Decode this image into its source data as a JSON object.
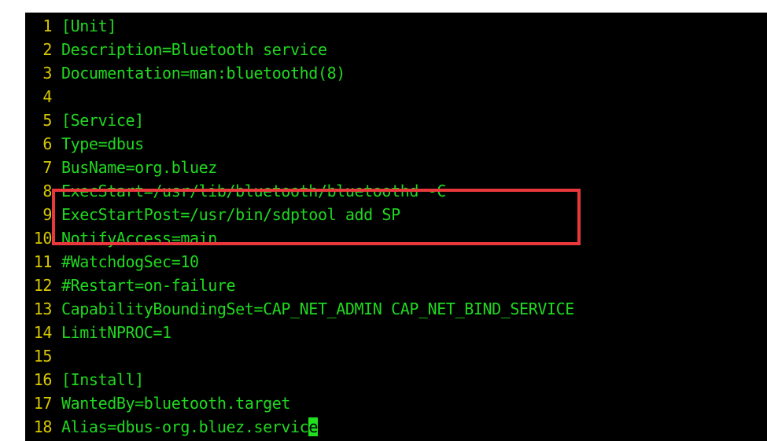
{
  "editor": {
    "lines": [
      {
        "num": "1",
        "text": "[Unit]"
      },
      {
        "num": "2",
        "text": "Description=Bluetooth service"
      },
      {
        "num": "3",
        "text": "Documentation=man:bluetoothd(8)"
      },
      {
        "num": "4",
        "text": ""
      },
      {
        "num": "5",
        "text": "[Service]"
      },
      {
        "num": "6",
        "text": "Type=dbus"
      },
      {
        "num": "7",
        "text": "BusName=org.bluez"
      },
      {
        "num": "8",
        "text": "ExecStart=/usr/lib/bluetooth/bluetoothd -C"
      },
      {
        "num": "9",
        "text": "ExecStartPost=/usr/bin/sdptool add SP"
      },
      {
        "num": "10",
        "text": "NotifyAccess=main"
      },
      {
        "num": "11",
        "text": "#WatchdogSec=10"
      },
      {
        "num": "12",
        "text": "#Restart=on-failure"
      },
      {
        "num": "13",
        "text": "CapabilityBoundingSet=CAP_NET_ADMIN CAP_NET_BIND_SERVICE"
      },
      {
        "num": "14",
        "text": "LimitNPROC=1"
      },
      {
        "num": "15",
        "text": ""
      },
      {
        "num": "16",
        "text": "[Install]"
      },
      {
        "num": "17",
        "text": "WantedBy=bluetooth.target"
      },
      {
        "num": "18",
        "text": "Alias=dbus-org.bluez.servic",
        "cursor_char": "e"
      }
    ]
  },
  "colors": {
    "background": "#000000",
    "line_number": "#d8c800",
    "code_text": "#20d820",
    "cursor": "#20e020",
    "highlight_border": "#e8383c"
  }
}
